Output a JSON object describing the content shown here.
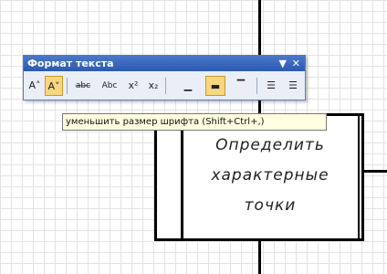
{
  "toolbar": {
    "title": "Формат текста",
    "dropdown_glyph": "▼",
    "close_glyph": "✕",
    "buttons": [
      {
        "name": "increase-font-button",
        "glyph": "A˄",
        "active": false
      },
      {
        "name": "decrease-font-button",
        "glyph": "A˅",
        "active": true
      },
      {
        "name": "strikethrough-button",
        "glyph": "a̶b̶c̶",
        "active": false
      },
      {
        "name": "abc-button",
        "glyph": "Abc",
        "active": false
      },
      {
        "name": "superscript-button",
        "glyph": "x²",
        "active": false
      },
      {
        "name": "subscript-button",
        "glyph": "x₂",
        "active": false
      },
      {
        "name": "align-bottom-button",
        "glyph": "▁",
        "active": false
      },
      {
        "name": "align-middle-button",
        "glyph": "▬",
        "active": true
      },
      {
        "name": "align-top-button",
        "glyph": "▔",
        "active": false
      },
      {
        "name": "bullets-button",
        "glyph": "☰",
        "active": false
      },
      {
        "name": "numbering-button",
        "glyph": "☰",
        "active": false
      }
    ]
  },
  "tooltip": {
    "text": "уменьшить размер шрифта (Shift+Ctrl+,)"
  },
  "block": {
    "lines": [
      "Определить",
      "характерные",
      "точки"
    ]
  }
}
